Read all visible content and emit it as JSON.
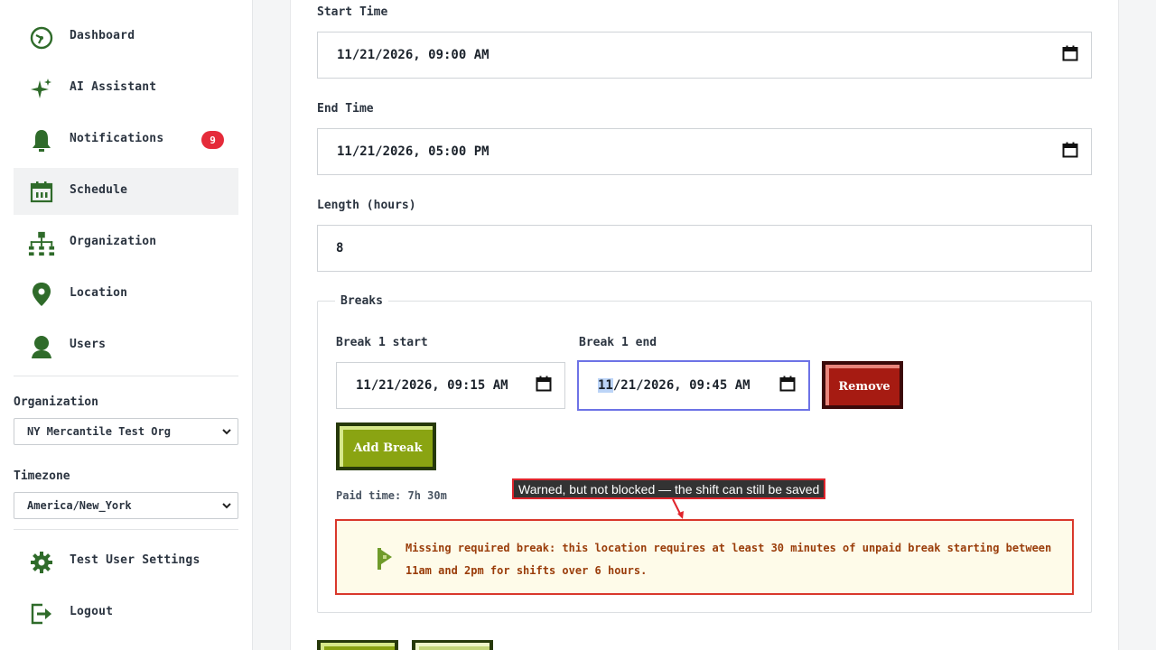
{
  "sidebar": {
    "items": [
      {
        "label": "Dashboard",
        "icon": "dashboard-icon"
      },
      {
        "label": "AI Assistant",
        "icon": "sparkle-icon"
      },
      {
        "label": "Notifications",
        "icon": "bell-icon",
        "badge": "9"
      },
      {
        "label": "Schedule",
        "icon": "calendar-icon",
        "active": true
      },
      {
        "label": "Organization",
        "icon": "org-chart-icon"
      },
      {
        "label": "Location",
        "icon": "location-pin-icon"
      },
      {
        "label": "Users",
        "icon": "user-icon"
      }
    ],
    "organization_label": "Organization",
    "organization_value": "NY Mercantile Test Org",
    "timezone_label": "Timezone",
    "timezone_value": "America/New_York",
    "settings_label": "Test User Settings",
    "logout_label": "Logout"
  },
  "form": {
    "start_time_label": "Start Time",
    "start_time_value": "11/21/2026, 09:00 AM",
    "end_time_label": "End Time",
    "end_time_value": "11/21/2026, 05:00 PM",
    "length_label": "Length (hours)",
    "length_value": "8",
    "breaks_legend": "Breaks",
    "break1_start_label": "Break 1 start",
    "break1_start_value": "11/21/2026, 09:15 AM",
    "break1_end_label": "Break 1 end",
    "break1_end_month": "11",
    "break1_end_rest": "/21/2026, 09:45 AM",
    "remove_label": "Remove",
    "add_break_label": "Add Break",
    "paid_time": "Paid time: 7h 30m",
    "warning_text": "Missing required break: this location requires at least 30 minutes of unpaid break starting between 11am and 2pm for shifts over 6 hours."
  },
  "callout": "Warned, but not blocked — the shift can still be saved",
  "colors": {
    "accent_green": "#8aa412",
    "danger_red": "#a61b12",
    "badge_red": "#e52b3a",
    "icon_green": "#2f6b2a"
  }
}
